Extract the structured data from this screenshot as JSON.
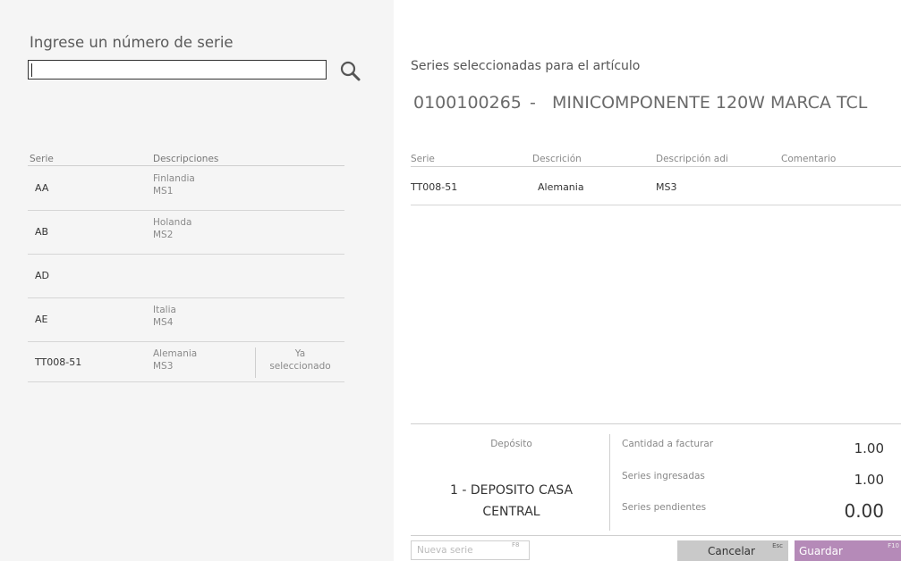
{
  "search": {
    "label": "Ingrese un número de serie",
    "value": "",
    "icon": "search-icon"
  },
  "serial_list": {
    "headers": {
      "serie": "Serie",
      "descripciones": "Descripciones"
    },
    "rows": [
      {
        "serie": "AA",
        "desc1": "Finlandia",
        "desc2": "MS1",
        "status1": "",
        "status2": ""
      },
      {
        "serie": "AB",
        "desc1": "Holanda",
        "desc2": "MS2",
        "status1": "",
        "status2": ""
      },
      {
        "serie": "AD",
        "desc1": "",
        "desc2": "",
        "status1": "",
        "status2": ""
      },
      {
        "serie": "AE",
        "desc1": "Italia",
        "desc2": "MS4",
        "status1": "",
        "status2": ""
      },
      {
        "serie": "TT008-51",
        "desc1": "Alemania",
        "desc2": "MS3",
        "status1": "Ya",
        "status2": "seleccionado"
      }
    ]
  },
  "selected": {
    "title": "Series seleccionadas para el artículo",
    "article_code": "0100100265",
    "article_sep": "-",
    "article_description": "MINICOMPONENTE 120W MARCA TCL",
    "headers": {
      "serie": "Serie",
      "descripcion": "Descrición",
      "descripcion_adi": "Descripción adi",
      "comentario": "Comentario"
    },
    "rows": [
      {
        "serie": "TT008-51",
        "descripcion": "Alemania",
        "descripcion_adi": "MS3",
        "comentario": ""
      }
    ]
  },
  "summary": {
    "deposito_label": "Depósito",
    "deposito_line1": "1 - DEPOSITO CASA",
    "deposito_line2": "CENTRAL",
    "cantidad_label": "Cantidad a facturar",
    "cantidad_value": "1.00",
    "ingresadas_label": "Series ingresadas",
    "ingresadas_value": "1.00",
    "pendientes_label": "Series pendientes",
    "pendientes_value": "0.00"
  },
  "footer": {
    "new_serie_placeholder": "Nueva serie",
    "new_serie_key": "F8",
    "cancel_label": "Cancelar",
    "cancel_key": "Esc",
    "save_label": "Guardar",
    "save_key": "F10"
  },
  "colors": {
    "left_panel_bg": "#f5f5f5",
    "save_button_bg": "#b58ab8",
    "cancel_button_bg": "#c9c9c9"
  }
}
